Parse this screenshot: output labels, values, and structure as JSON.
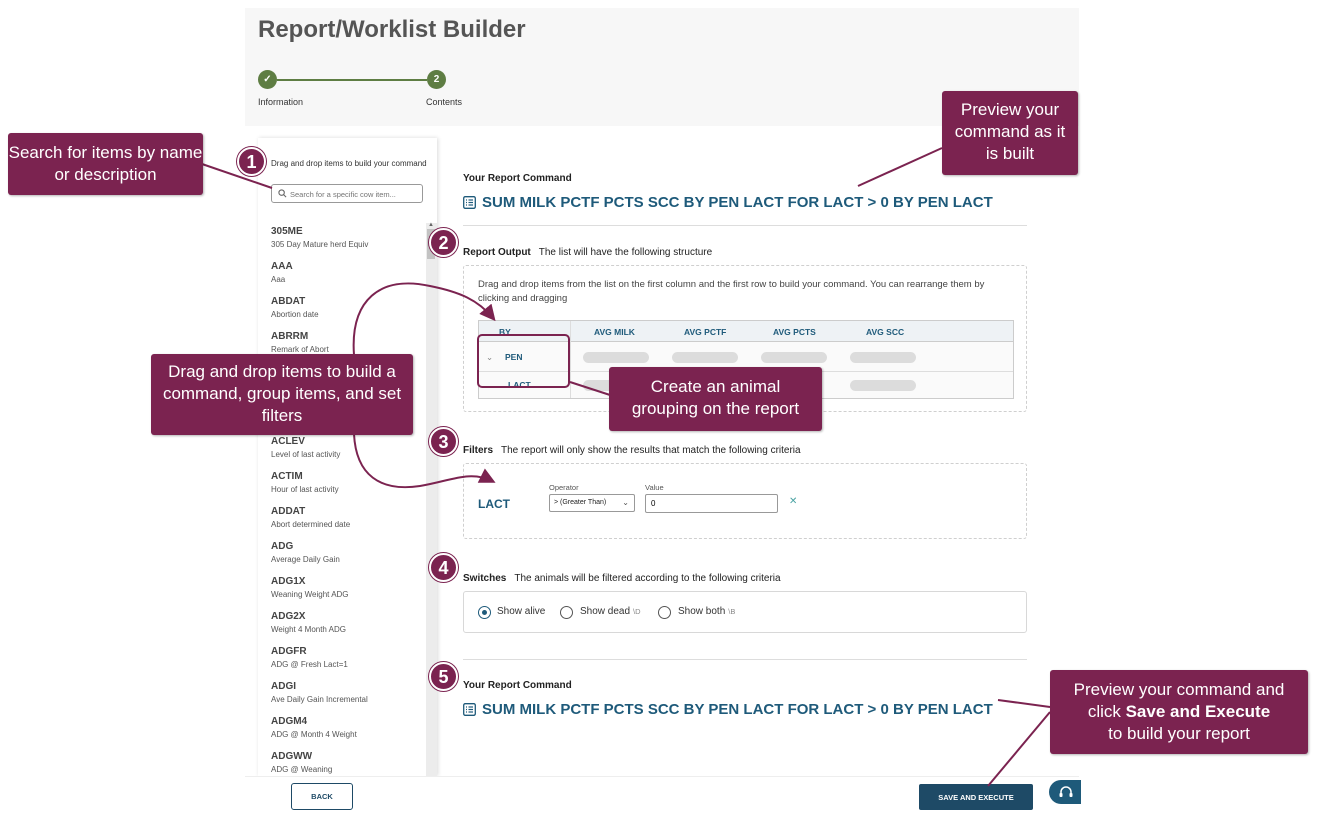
{
  "header": {
    "title": "Report/Worklist Builder",
    "steps": [
      {
        "number": "✓",
        "label": "Information"
      },
      {
        "number": "2",
        "label": "Contents"
      }
    ]
  },
  "left_panel": {
    "hint": "Drag and drop items to build your command",
    "search_placeholder": "Search for a specific cow item...",
    "items": [
      {
        "code": "305ME",
        "desc": "305 Day Mature herd Equiv"
      },
      {
        "code": "AAA",
        "desc": "Aaa"
      },
      {
        "code": "ABDAT",
        "desc": "Abortion date"
      },
      {
        "code": "ABRRM",
        "desc": "Remark of Abort"
      },
      {
        "code": "ACLEV",
        "desc": "Level of last activity"
      },
      {
        "code": "ACTIM",
        "desc": "Hour of last activity"
      },
      {
        "code": "ADDAT",
        "desc": "Abort determined date"
      },
      {
        "code": "ADG",
        "desc": "Average Daily Gain"
      },
      {
        "code": "ADG1X",
        "desc": "Weaning Weight ADG"
      },
      {
        "code": "ADG2X",
        "desc": "Weight 4 Month ADG"
      },
      {
        "code": "ADGFR",
        "desc": "ADG @ Fresh Lact=1"
      },
      {
        "code": "ADGI",
        "desc": "Ave Daily Gain Incremental"
      },
      {
        "code": "ADGM4",
        "desc": "ADG @ Month 4 Weight"
      },
      {
        "code": "ADGWW",
        "desc": "ADG @ Weaning"
      }
    ]
  },
  "command_preview": {
    "title": "Your Report Command",
    "text": "SUM MILK PCTF PCTS SCC BY PEN LACT FOR LACT > 0 BY PEN LACT"
  },
  "report_output": {
    "title": "Report Output",
    "subtitle": "The list will have the following structure",
    "hint": "Drag and drop items from the list on the first column and the first row to build your command. You can rearrange them by clicking and dragging",
    "columns": [
      "BY",
      "AVG MILK",
      "AVG PCTF",
      "AVG PCTS",
      "AVG SCC"
    ],
    "rows": [
      "PEN",
      "LACT"
    ]
  },
  "filters": {
    "title": "Filters",
    "subtitle": "The report will only show the results that match the following criteria",
    "field": "LACT",
    "operator_label": "Operator",
    "operator_value": "> (Greater Than)",
    "value_label": "Value",
    "value": "0"
  },
  "switches": {
    "title": "Switches",
    "subtitle": "The animals will be filtered according to the following criteria",
    "options": [
      {
        "label": "Show alive",
        "key": "",
        "selected": true
      },
      {
        "label": "Show dead",
        "key": "\\D",
        "selected": false
      },
      {
        "label": "Show both",
        "key": "\\B",
        "selected": false
      }
    ]
  },
  "footer": {
    "back_label": "BACK",
    "save_label": "SAVE AND EXECUTE"
  },
  "annotations": {
    "search": "Search for items by name or description",
    "drag": "Drag and drop items to build a command, group items, and set filters",
    "preview": "Preview your command as it is built",
    "grouping": "Create an animal grouping on the report",
    "save_line1": "Preview your command and",
    "save_line2_prefix": "click ",
    "save_line2_bold": "Save and Execute",
    "save_line3": "to build your report",
    "badges": [
      "1",
      "2",
      "3",
      "4",
      "5"
    ]
  },
  "colors": {
    "callout": "#7b2350",
    "accent": "#1e5a7a",
    "step": "#5e7d43"
  }
}
